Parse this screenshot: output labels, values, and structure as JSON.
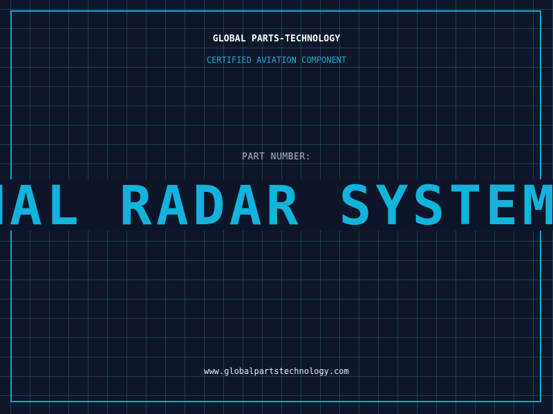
{
  "header": {
    "company": "GLOBAL PARTS-TECHNOLOGY",
    "subtitle": "CERTIFIED AVIATION COMPONENT"
  },
  "part": {
    "label": "PART NUMBER:",
    "scrolling_text": "ONAL RADAR SYSTEM P"
  },
  "footer": {
    "url": "www.globalpartstechnology.com"
  },
  "colors": {
    "background": "#0f172a",
    "accent": "#1aa6d0",
    "grid": "#227896",
    "band_text": "#12b3dd"
  }
}
